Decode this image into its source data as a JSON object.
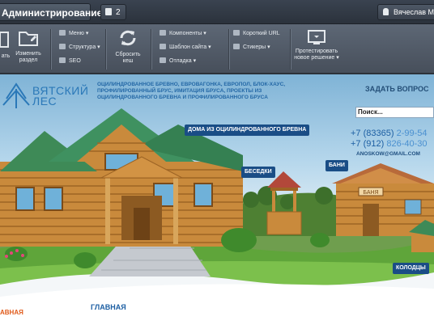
{
  "admin": {
    "panel_label": "Администрирование",
    "notifications_count": "2",
    "user_name": "Вячеслав Мас"
  },
  "toolbar": {
    "edit_partial": "ать",
    "change_section": "Изменить раздел",
    "menu": "Меню",
    "structure": "Структура",
    "seo": "SEO",
    "reset_cache": "Сбросить кеш",
    "components": "Компоненты",
    "site_template": "Шаблон сайта",
    "debug": "Отладка",
    "short_url": "Короткий URL",
    "stickers": "Стикеры",
    "test_solution": "Протестировать новое решение"
  },
  "site": {
    "logo_line1": "ВЯТСКИЙ",
    "logo_line2": "ЛЕС",
    "tagline": "ОЦИЛИНДРОВАННОЕ БРЕВНО, ЕВРОВАГОНКА, ЕВРОПОЛ, БЛОК-ХАУС, ПРОФИЛИРОВАННЫЙ БРУС, ИМИТАЦИЯ БРУСА, ПРОЕКТЫ ИЗ ОЦИЛИНДРОВАННОГО БРЕВНА И ПРОФИЛИРОВАННОГО БРУСА",
    "ask_question": "ЗАДАТЬ ВОПРОС",
    "search_placeholder": "Поиск...",
    "phone1_code": "+7 (83365)",
    "phone1_num": "2-99-54",
    "phone2_code": "+7 (912)",
    "phone2_num": "826-40-30",
    "email": "ANOSKOW@GMAIL.COM",
    "label_houses": "ДОМА ИЗ ОЦИЛИНДРОВАННОГО БРЕВНА",
    "label_gazebos": "БЕСЕДКИ",
    "label_baths": "БАНИ",
    "label_wells": "КОЛОДЦЫ",
    "banya_sign": "БАНЯ",
    "main_heading": "ГЛАВНАЯ",
    "side_link": "АВНАЯ"
  },
  "colors": {
    "accent": "#1a4d86",
    "admin_bar": "#3a4350",
    "toolbar": "#5d6775",
    "side_link": "#e05a1a"
  }
}
